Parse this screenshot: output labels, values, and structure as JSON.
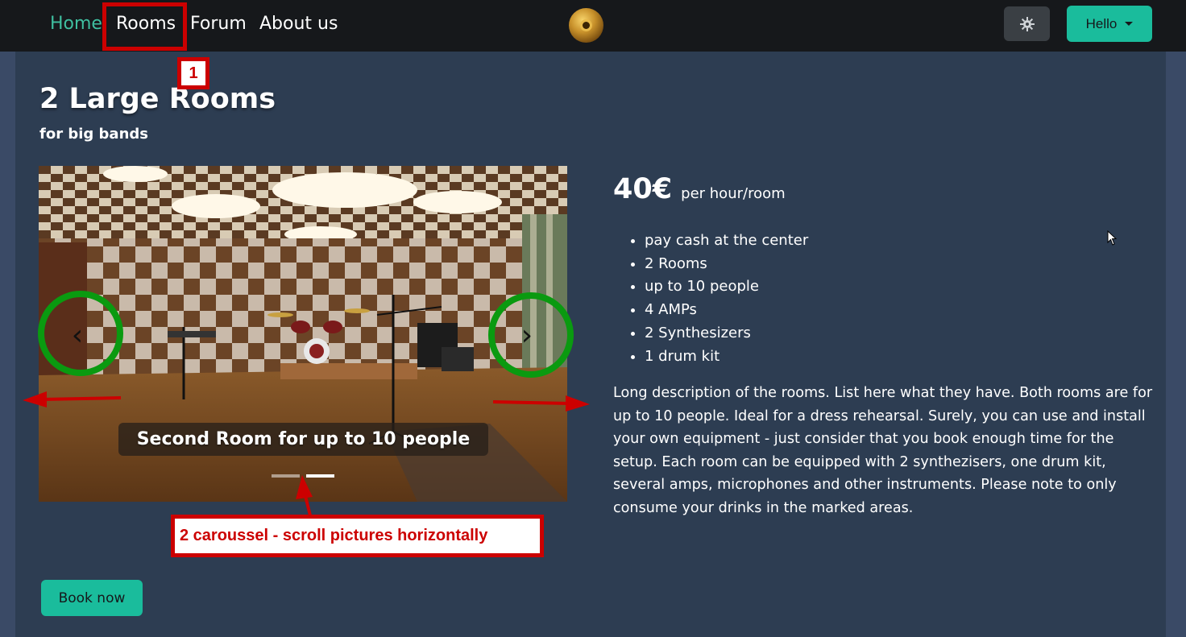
{
  "nav": {
    "home": "Home",
    "rooms": "Rooms",
    "forum": "Forum",
    "about": "About us",
    "theme_icon": "gear-icon",
    "user_menu": "Hello"
  },
  "page": {
    "title": "2 Large Rooms",
    "subtitle": "for big bands"
  },
  "carousel": {
    "caption": "Second Room for up to 10 people",
    "prev_icon": "chevron-left-icon",
    "next_icon": "chevron-right-icon",
    "prev_glyph": "‹",
    "next_glyph": "›",
    "slide_count": 2,
    "active_index": 2
  },
  "details": {
    "price": "40€",
    "price_unit": "per hour/room",
    "features": [
      "pay cash at the center",
      "2 Rooms",
      "up to 10 people",
      "4 AMPs",
      "2 Synthesizers",
      "1 drum kit"
    ],
    "description": "Long description of the rooms. List here what they have. Both rooms are for up to 10 people. Ideal for a dress rehearsal. Surely, you can use and install your own equipment - just consider that you book enough time for the setup. Each room can be equipped with 2 synthezisers, one drum kit, several amps, microphones and other instruments. Please note to only consume your drinks in the marked areas."
  },
  "actions": {
    "book": "Book now"
  },
  "annotations": {
    "tag_1": "1",
    "tag_2": "2 caroussel - scroll pictures horizontally"
  },
  "colors": {
    "accent": "#1abc9c",
    "navbar": "#16181b",
    "page_bg": "#2d3d52",
    "annotation_red": "#cc0000",
    "annotation_green": "#0a9a10"
  }
}
